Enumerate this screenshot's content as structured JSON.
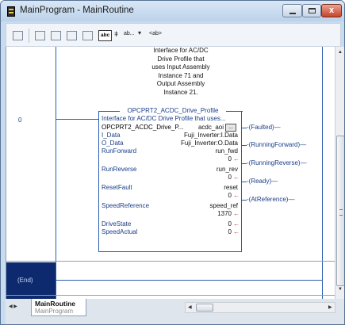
{
  "window": {
    "title": "MainProgram - MainRoutine",
    "close_glyph": "x"
  },
  "toolbar": {
    "items": [
      "abc",
      "ab...",
      "<ab>"
    ]
  },
  "rung": {
    "number": "0",
    "comment_lines": [
      "Interface for AC/DC",
      "Drive Profile that",
      "uses Input Assembly",
      "Instance 71 and",
      "Output Assembly",
      "Instance 21."
    ]
  },
  "aoi": {
    "name": "OPCPRT2_ACDC_Drive_Profile",
    "description": "Interface for AC/DC Drive Profile that uses...",
    "rows": [
      {
        "label": "OPCPRT2_ACDC_Drive_P...",
        "value": "acdc_aoi",
        "sub": ""
      },
      {
        "label": "I_Data",
        "value": "Fuji_Inverter:I.Data",
        "sub": ""
      },
      {
        "label": "O_Data",
        "value": "Fuji_Inverter:O.Data",
        "sub": ""
      },
      {
        "label": "RunForward",
        "value": "run_fwd",
        "sub": "0"
      },
      {
        "label": "RunReverse",
        "value": "run_rev",
        "sub": "0"
      },
      {
        "label": "ResetFault",
        "value": "reset",
        "sub": "0"
      },
      {
        "label": "SpeedReference",
        "value": "speed_ref",
        "sub": "1370"
      },
      {
        "label": "DriveState",
        "value": "0",
        "sub": ""
      },
      {
        "label": "SpeedActual",
        "value": "0",
        "sub": ""
      }
    ],
    "arrow_glyph": "←",
    "ellipsis": "..."
  },
  "outputs": [
    "Faulted",
    "RunningForward",
    "RunningReverse",
    "Ready",
    "AtReference"
  ],
  "end_label": "(End)",
  "tab": {
    "routine": "MainRoutine",
    "program": "MainProgram"
  }
}
